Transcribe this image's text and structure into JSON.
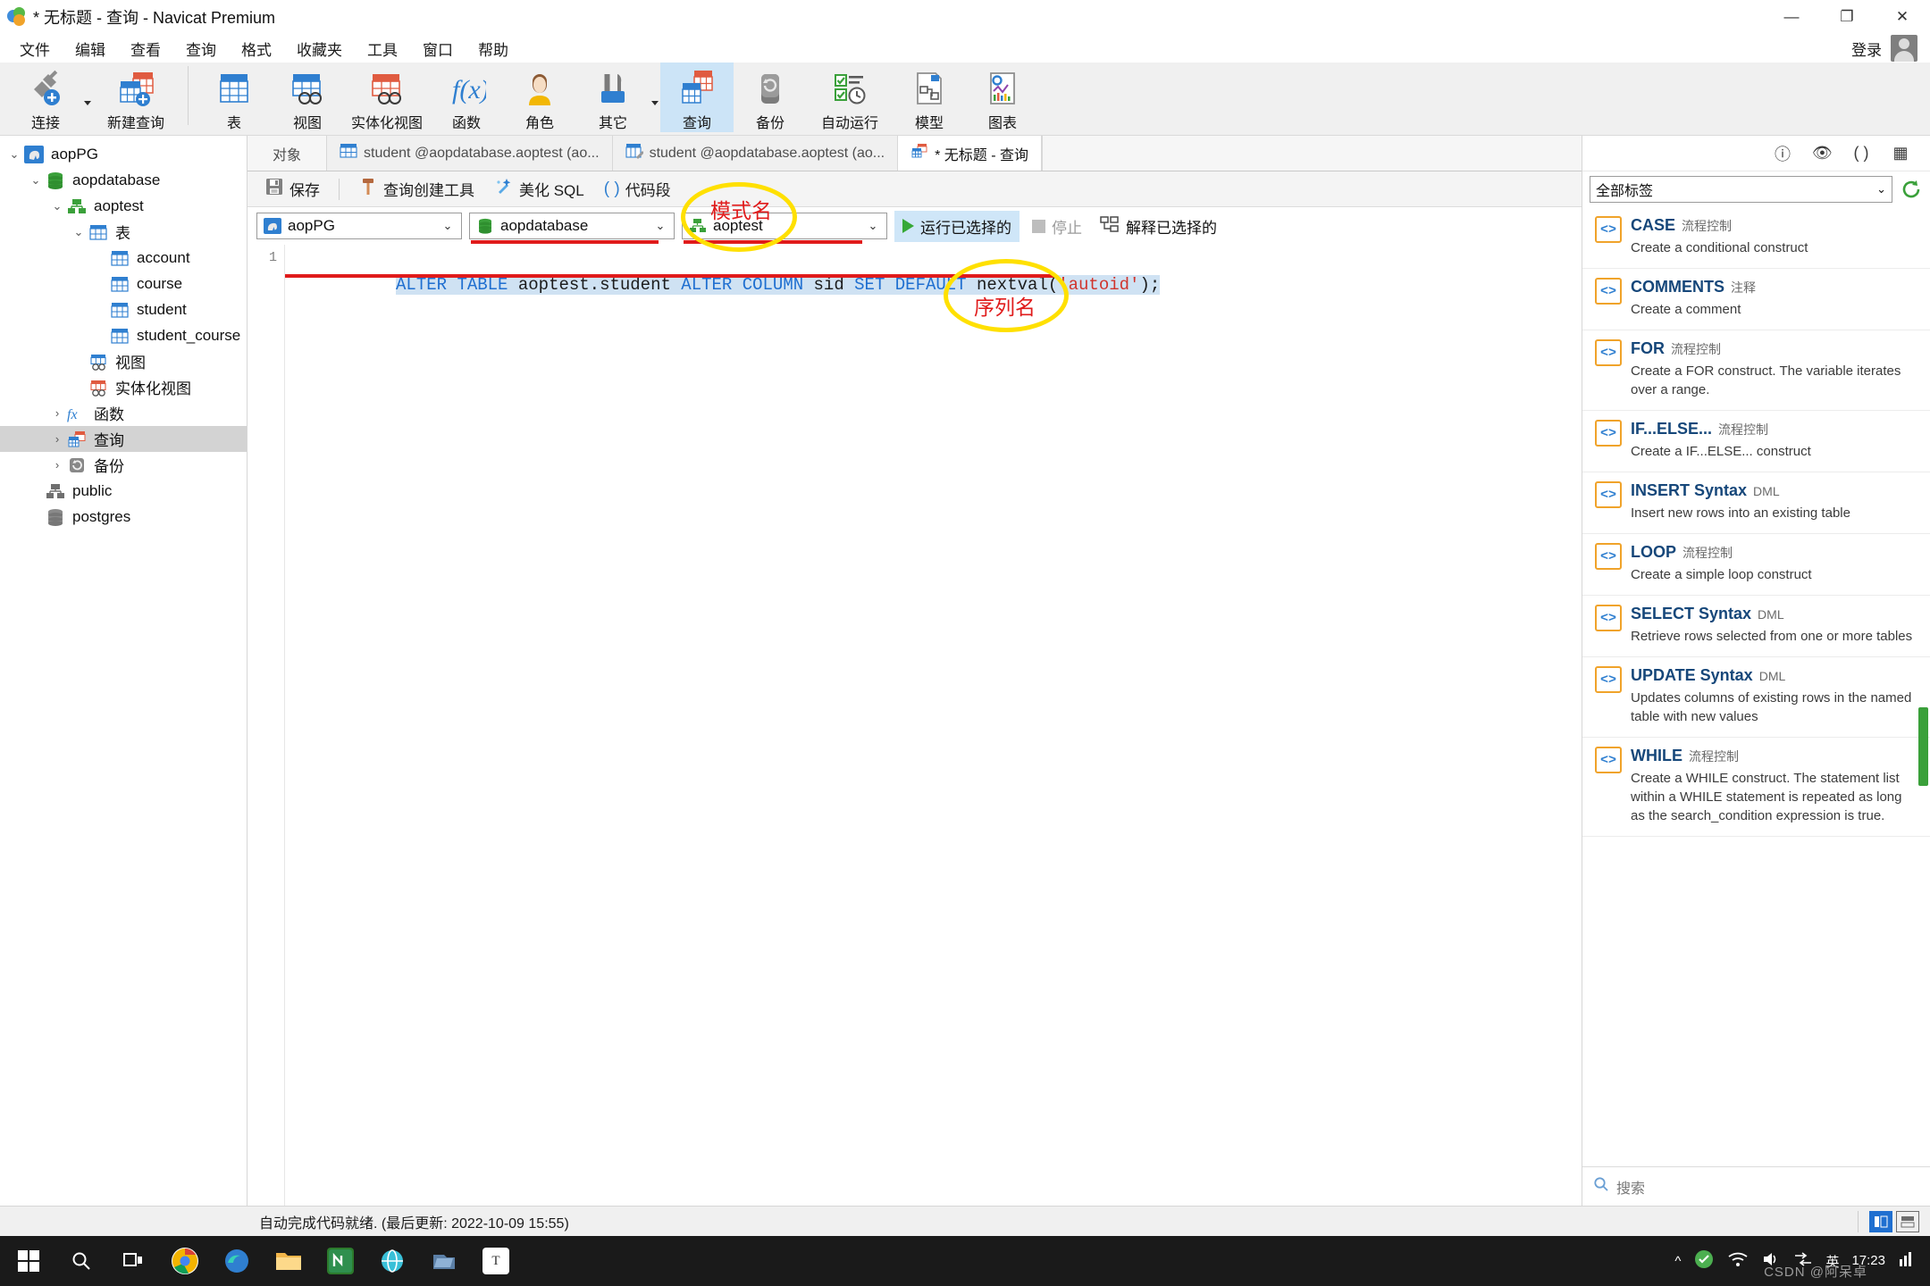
{
  "window": {
    "title": "* 无标题 - 查询 - Navicat Premium",
    "minimize": "—",
    "maximize": "❐",
    "close": "✕"
  },
  "menubar": {
    "items": [
      "文件",
      "编辑",
      "查看",
      "查询",
      "格式",
      "收藏夹",
      "工具",
      "窗口",
      "帮助"
    ],
    "login_label": "登录"
  },
  "toolbar": {
    "group1": [
      {
        "label": "连接",
        "icon": "connection-plug-icon"
      },
      {
        "label": "新建查询",
        "icon": "new-query-icon"
      }
    ],
    "group2": [
      {
        "label": "表",
        "icon": "table-icon"
      },
      {
        "label": "视图",
        "icon": "view-icon"
      },
      {
        "label": "实体化视图",
        "icon": "materialized-view-icon"
      },
      {
        "label": "函数",
        "icon": "function-fx-icon"
      },
      {
        "label": "角色",
        "icon": "role-person-icon"
      },
      {
        "label": "其它",
        "icon": "other-tools-icon"
      },
      {
        "label": "查询",
        "icon": "query-icon",
        "selected": true
      },
      {
        "label": "备份",
        "icon": "backup-icon"
      },
      {
        "label": "自动运行",
        "icon": "automation-icon"
      },
      {
        "label": "模型",
        "icon": "model-icon"
      },
      {
        "label": "图表",
        "icon": "chart-icon"
      }
    ]
  },
  "sidebar": {
    "nodes": [
      {
        "label": "aopPG",
        "depth": 0,
        "twisty": "down",
        "icon": "postgres-elephant-icon"
      },
      {
        "label": "aopdatabase",
        "depth": 1,
        "twisty": "down",
        "icon": "database-icon"
      },
      {
        "label": "aoptest",
        "depth": 2,
        "twisty": "down",
        "icon": "schema-icon"
      },
      {
        "label": "表",
        "depth": 3,
        "twisty": "down",
        "icon": "table-icon"
      },
      {
        "label": "account",
        "depth": 4,
        "twisty": "none",
        "icon": "table-icon"
      },
      {
        "label": "course",
        "depth": 4,
        "twisty": "none",
        "icon": "table-icon"
      },
      {
        "label": "student",
        "depth": 4,
        "twisty": "none",
        "icon": "table-icon"
      },
      {
        "label": "student_course",
        "depth": 4,
        "twisty": "none",
        "icon": "table-icon"
      },
      {
        "label": "视图",
        "depth": 3,
        "twisty": "none",
        "icon": "view-icon"
      },
      {
        "label": "实体化视图",
        "depth": 3,
        "twisty": "none",
        "icon": "materialized-view-icon"
      },
      {
        "label": "函数",
        "depth": 3,
        "twisty": "right",
        "icon": "function-fx-icon"
      },
      {
        "label": "查询",
        "depth": 3,
        "twisty": "right",
        "icon": "query-icon",
        "selected": true
      },
      {
        "label": "备份",
        "depth": 3,
        "twisty": "right",
        "icon": "backup-icon"
      },
      {
        "label": "public",
        "depth": 2,
        "twisty": "none",
        "icon": "schema-icon"
      },
      {
        "label": "postgres",
        "depth": 1,
        "twisty": "none",
        "icon": "database-icon"
      }
    ]
  },
  "tabs": [
    {
      "label": "对象",
      "icon": "none",
      "active": false,
      "kind": "object"
    },
    {
      "label": "student @aopdatabase.aoptest (ao...",
      "icon": "table-icon",
      "active": false,
      "kind": "table"
    },
    {
      "label": "student @aopdatabase.aoptest (ao...",
      "icon": "table-design-icon",
      "active": false,
      "kind": "design"
    },
    {
      "label": "* 无标题 - 查询",
      "icon": "query-icon",
      "active": true,
      "kind": "query"
    }
  ],
  "query_toolbar": {
    "save": "保存",
    "query_builder": "查询创建工具",
    "beautify": "美化 SQL",
    "snippets": "代码段"
  },
  "connection_row": {
    "connection": "aopPG",
    "database": "aopdatabase",
    "schema": "aoptest",
    "run_selected": "运行已选择的",
    "stop": "停止",
    "explain_selected": "解释已选择的",
    "arrow": "⌄"
  },
  "editor": {
    "line_number": "1",
    "sql_tokens": [
      {
        "text": "ALTER TABLE",
        "cls": "kw"
      },
      {
        "text": " ",
        "cls": "pn"
      },
      {
        "text": "aoptest.student",
        "cls": "id"
      },
      {
        "text": " ",
        "cls": "pn"
      },
      {
        "text": "ALTER COLUMN",
        "cls": "kw"
      },
      {
        "text": " ",
        "cls": "pn"
      },
      {
        "text": "sid",
        "cls": "id"
      },
      {
        "text": " ",
        "cls": "pn"
      },
      {
        "text": "SET DEFAULT",
        "cls": "kw"
      },
      {
        "text": " ",
        "cls": "pn"
      },
      {
        "text": "nextval",
        "cls": "id"
      },
      {
        "text": "(",
        "cls": "pn"
      },
      {
        "text": "'autoid'",
        "cls": "str"
      },
      {
        "text": ");",
        "cls": "pn"
      }
    ],
    "full_sql": "ALTER TABLE aoptest.student ALTER COLUMN sid SET DEFAULT nextval('autoid');"
  },
  "annotations": [
    {
      "text": "模式名",
      "name": "annotation-schema-name"
    },
    {
      "text": "序列名",
      "name": "annotation-sequence-name"
    }
  ],
  "right_panel": {
    "header_icons": [
      "info-icon",
      "eye-icon",
      "parentheses-icon",
      "grid-icon"
    ],
    "filter_value": "全部标签",
    "refresh_icon": "refresh-icon",
    "search_placeholder": "搜索",
    "snippets": [
      {
        "title": "CASE",
        "tag": "流程控制",
        "desc": "Create a conditional construct"
      },
      {
        "title": "COMMENTS",
        "tag": "注释",
        "desc": "Create a comment"
      },
      {
        "title": "FOR",
        "tag": "流程控制",
        "desc": "Create a FOR construct. The variable iterates over a range."
      },
      {
        "title": "IF...ELSE...",
        "tag": "流程控制",
        "desc": "Create a IF...ELSE... construct"
      },
      {
        "title": "INSERT Syntax",
        "tag": "DML",
        "desc": "Insert new rows into an existing table"
      },
      {
        "title": "LOOP",
        "tag": "流程控制",
        "desc": "Create a simple loop construct"
      },
      {
        "title": "SELECT Syntax",
        "tag": "DML",
        "desc": "Retrieve rows selected from one or more tables"
      },
      {
        "title": "UPDATE Syntax",
        "tag": "DML",
        "desc": "Updates columns of existing rows in the named table with new values"
      },
      {
        "title": "WHILE",
        "tag": "流程控制",
        "desc": "Create a WHILE construct. The statement list within a WHILE statement is repeated as long as the search_condition expression is true."
      }
    ]
  },
  "statusbar": {
    "message": "自动完成代码就绪. (最后更新: 2022-10-09 15:55)"
  },
  "taskbar": {
    "time": "17:23",
    "lang": "英",
    "watermark": "CSDN @阿呆卓"
  },
  "colors": {
    "accent": "#1f6fd0",
    "selection": "#cce4f7",
    "annotation_red": "#e01b1b",
    "annotation_yellow": "#ffe000",
    "green": "#36a836"
  }
}
